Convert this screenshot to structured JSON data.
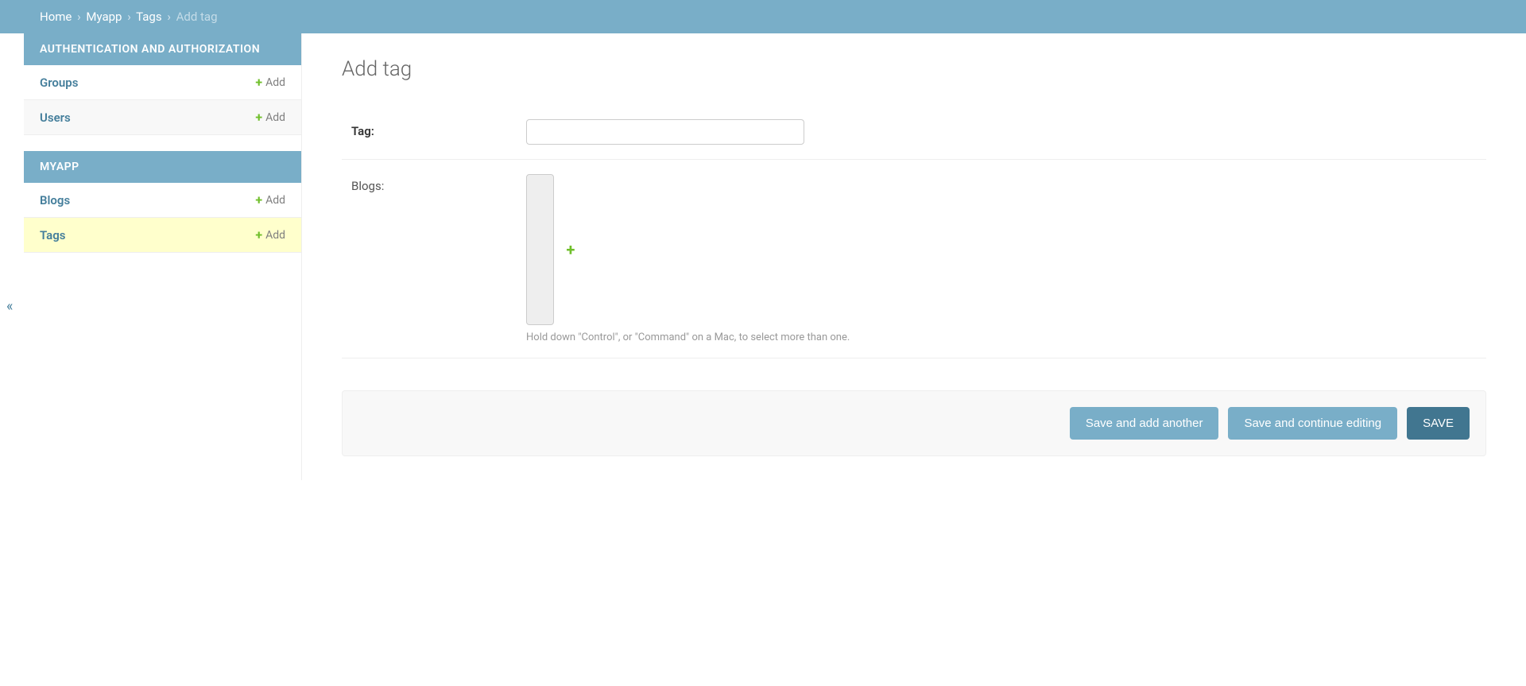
{
  "breadcrumbs": {
    "home": "Home",
    "app": "Myapp",
    "model": "Tags",
    "current": "Add tag"
  },
  "sidebar": {
    "groups": [
      {
        "title": "AUTHENTICATION AND AUTHORIZATION",
        "items": [
          {
            "name": "Groups",
            "add": "Add"
          },
          {
            "name": "Users",
            "add": "Add"
          }
        ]
      },
      {
        "title": "MYAPP",
        "items": [
          {
            "name": "Blogs",
            "add": "Add"
          },
          {
            "name": "Tags",
            "add": "Add"
          }
        ]
      }
    ]
  },
  "page": {
    "title": "Add tag"
  },
  "form": {
    "tag_label": "Tag:",
    "tag_value": "",
    "blogs_label": "Blogs:",
    "blogs_help": "Hold down \"Control\", or \"Command\" on a Mac, to select more than one."
  },
  "buttons": {
    "save_add_another": "Save and add another",
    "save_continue": "Save and continue editing",
    "save": "SAVE"
  },
  "collapse_glyph": "«"
}
